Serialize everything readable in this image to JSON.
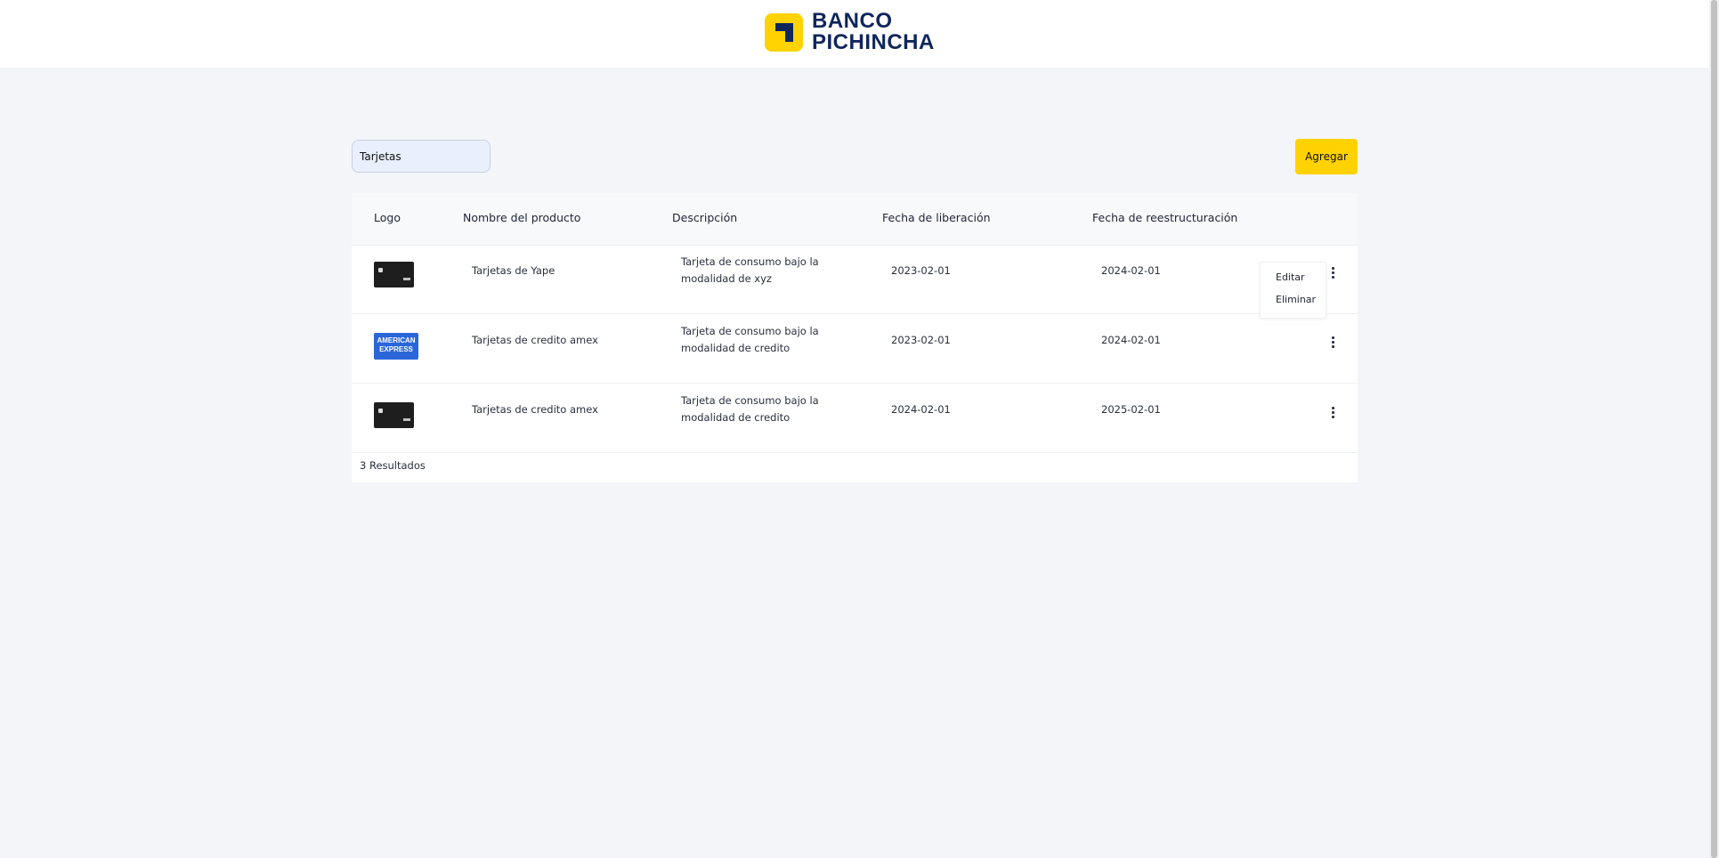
{
  "brand": {
    "line1": "BANCO",
    "line2": "PICHINCHA",
    "yellow": "#ffd200",
    "navy": "#0f265c"
  },
  "toolbar": {
    "search_value": "Tarjetas",
    "add_label": "Agregar"
  },
  "table": {
    "headers": [
      "Logo",
      "Nombre del producto",
      "Descripción",
      "Fecha de liberación",
      "Fecha de reestructuración"
    ],
    "rows": [
      {
        "logo": "dark-card",
        "name": "Tarjetas de Yape",
        "description": "Tarjeta de consumo bajo la modalidad de xyz",
        "release_date": "2023-02-01",
        "restructure_date": "2024-02-01"
      },
      {
        "logo": "amex-card",
        "logo_text_1": "AMERICAN",
        "logo_text_2": "EXPRESS",
        "name": "Tarjetas de credito amex",
        "description": "Tarjeta de consumo bajo la modalidad de credito",
        "release_date": "2023-02-01",
        "restructure_date": "2024-02-01"
      },
      {
        "logo": "dark-card",
        "name": "Tarjetas de credito amex",
        "description": "Tarjeta de consumo bajo la modalidad de credito",
        "release_date": "2024-02-01",
        "restructure_date": "2025-02-01"
      }
    ],
    "row_menu": {
      "edit_label": "Editar",
      "delete_label": "Eliminar"
    },
    "results_text": "3 Resultados"
  },
  "icons": {
    "row_action": "kebab-menu-icon"
  }
}
